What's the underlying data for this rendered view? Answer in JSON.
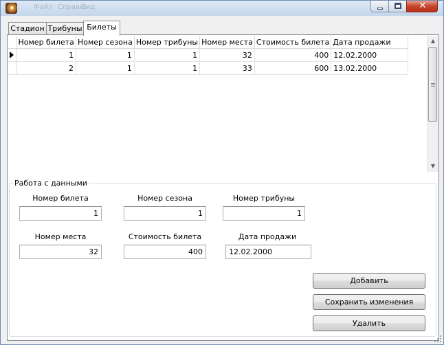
{
  "titlebar": {
    "ghost_menu": [
      "Файл",
      "Справка",
      "Вид"
    ],
    "caption_buttons": [
      "minimize-icon",
      "maximize-icon",
      "close-icon"
    ],
    "close_glyph": "✕"
  },
  "tabs": [
    {
      "label": "Стадион",
      "active": false
    },
    {
      "label": "Трибуны",
      "active": false
    },
    {
      "label": "Билеты",
      "active": true
    }
  ],
  "grid": {
    "columns": [
      "Номер билета",
      "Номер сезона",
      "Номер трибуны",
      "Номер места",
      "Стоимость билета",
      "Дата продажи"
    ],
    "rows": [
      [
        "1",
        "1",
        "1",
        "32",
        "400",
        "12.02.2000"
      ],
      [
        "2",
        "1",
        "1",
        "33",
        "600",
        "13.02.2000"
      ]
    ],
    "current_row": 0
  },
  "form": {
    "title": "Работа с данными",
    "ticket_no": {
      "label": "Номер билета",
      "value": "1"
    },
    "season_no": {
      "label": "Номер сезона",
      "value": "1"
    },
    "stand_no": {
      "label": "Номер трибуны",
      "value": "1"
    },
    "seat_no": {
      "label": "Номер места",
      "value": "32"
    },
    "price": {
      "label": "Стоимость билета",
      "value": "400"
    },
    "sale_date": {
      "label": "Дата продажи",
      "value": "12.02.2000"
    }
  },
  "buttons": {
    "add": "Добавить",
    "save": "Сохранить изменения",
    "delete": "Удалить"
  }
}
